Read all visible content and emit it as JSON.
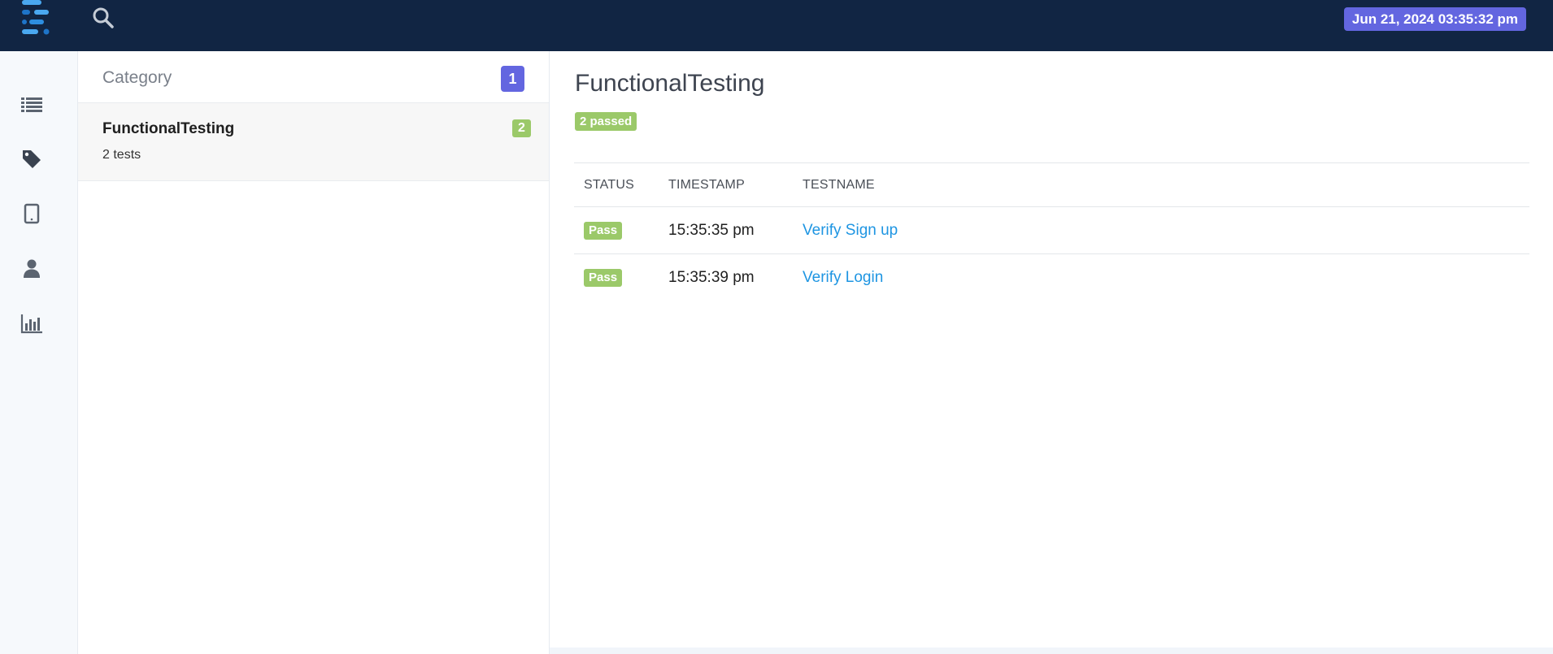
{
  "header": {
    "date": "Jun 21, 2024 03:35:32 pm",
    "icons": {
      "logo": "extent-logo",
      "search": "search-icon"
    }
  },
  "sidenav": {
    "icons": [
      "list-icon",
      "tag-icon",
      "tablet-icon",
      "user-icon",
      "bar-chart-icon"
    ]
  },
  "category_panel": {
    "title": "Category",
    "count": "1",
    "items": [
      {
        "name": "FunctionalTesting",
        "tests": "2 tests",
        "badge": "2"
      }
    ]
  },
  "detail": {
    "title": "FunctionalTesting",
    "passed_badge": "2 passed",
    "columns": [
      "STATUS",
      "TIMESTAMP",
      "TESTNAME"
    ],
    "rows": [
      {
        "status": "Pass",
        "timestamp": "15:35:35 pm",
        "testname": "Verify Sign up"
      },
      {
        "status": "Pass",
        "timestamp": "15:35:39 pm",
        "testname": "Verify Login"
      }
    ]
  },
  "colors": {
    "topbar": "#112543",
    "accent": "#6366e0",
    "pass": "#9bc969",
    "link": "#1e95e2"
  }
}
